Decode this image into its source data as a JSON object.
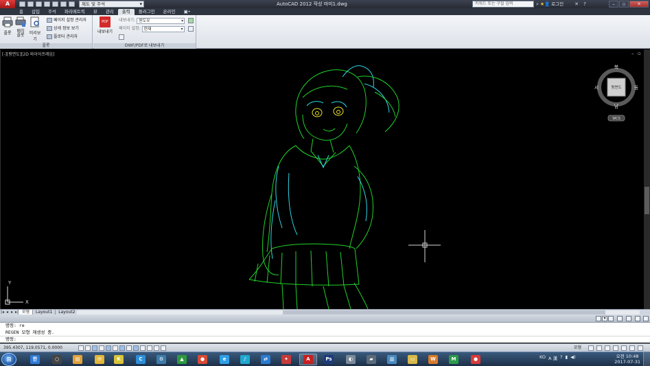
{
  "titlebar": {
    "app_logo": "A",
    "workspace": "제도 및 주석",
    "title": "AutoCAD 2012   작성 마미1.dwg",
    "search_placeholder": "키워드 또는 구절 입력",
    "login": "로그인",
    "icons": [
      "search-icon",
      "star-icon",
      "user-icon",
      "help-icon"
    ]
  },
  "tabs": [
    "홈",
    "삽입",
    "주석",
    "파라메트릭",
    "뷰",
    "관리",
    "출력",
    "플러그인",
    "온라인",
    "▣•"
  ],
  "ribbon": {
    "plot_panel": {
      "title": "플롯",
      "plot": "플롯",
      "batch_plot": "배치\n플롯",
      "preview": "미리보기",
      "page_setup": "페이지 설정 관리자",
      "details": "상세 정보 보기",
      "plotter_manager": "플로터 관리자"
    },
    "export_panel": {
      "title": "DWF/PDF로 내보내기",
      "export_button": "내보내기",
      "export_label": "내보내기:",
      "export_value": "윈도우",
      "page_setup_label": "페이지 설정:",
      "page_setup_value": "현재",
      "pdf_badge": "PDF"
    }
  },
  "viewport": {
    "label": "[-][평면도][2D 와이어프레임]",
    "viewcube": {
      "top_face": "평면도",
      "north": "북",
      "south": "남",
      "west": "서",
      "east": "동",
      "wcs": "WCS"
    },
    "ucs": {
      "x": "X",
      "y": "Y"
    },
    "drawing_colors": {
      "outline": "#22d32b",
      "detail": "#2fd7e6",
      "eyes": "#f2e82c"
    }
  },
  "layout_tabs": [
    "모형",
    "Layout1",
    "Layout2"
  ],
  "command": {
    "lines": [
      "명령: re",
      "REGEN 모형 재생성 중.",
      "",
      "명령:"
    ]
  },
  "status": {
    "coords": "395.4307, 119.0571, 0.0000",
    "model": "모형"
  },
  "taskbar": {
    "apps": [
      {
        "name": "hangul-icon",
        "label": "한",
        "color": "#2f7bd6"
      },
      {
        "name": "search-icon",
        "label": "○",
        "color": "#444"
      },
      {
        "name": "notes-icon",
        "label": "▤",
        "color": "#e0a23a"
      },
      {
        "name": "mail-icon",
        "label": "✉",
        "color": "#e2b63a"
      },
      {
        "name": "kakao-icon",
        "label": "K",
        "color": "#d7c43a"
      },
      {
        "name": "c-app-icon",
        "label": "C",
        "color": "#2d8fd8"
      },
      {
        "name": "settings-icon",
        "label": "⚙",
        "color": "#3d7ba8"
      },
      {
        "name": "vs-icon",
        "label": "▲",
        "color": "#2d9a3d"
      },
      {
        "name": "chrome-icon",
        "label": "●",
        "color": "#d94a35"
      },
      {
        "name": "ie-icon",
        "label": "e",
        "color": "#2f9ee6"
      },
      {
        "name": "music-icon",
        "label": "♪",
        "color": "#1fa7d0"
      },
      {
        "name": "teamviewer-icon",
        "label": "⇄",
        "color": "#2a7bd0"
      },
      {
        "name": "flashget-icon",
        "label": "✦",
        "color": "#c73a3a"
      },
      {
        "name": "autocad-icon",
        "label": "A",
        "color": "#c72020",
        "open": true
      },
      {
        "name": "photoshop-icon",
        "label": "Ps",
        "color": "#1d3b7a"
      },
      {
        "name": "media-icon",
        "label": "◐",
        "color": "#7a8a99"
      },
      {
        "name": "folder-icon",
        "label": "▰",
        "color": "#5a6a78"
      },
      {
        "name": "docs-icon",
        "label": "▥",
        "color": "#4a8ac0"
      },
      {
        "name": "explorer-icon",
        "label": "▭",
        "color": "#d9b94a"
      },
      {
        "name": "word-icon",
        "label": "W",
        "color": "#d97b2a"
      },
      {
        "name": "mq-icon",
        "label": "M",
        "color": "#2a9a4a"
      },
      {
        "name": "record-icon",
        "label": "●",
        "color": "#d93a3a"
      }
    ],
    "tray": [
      "KO",
      "A 漢",
      "?"
    ],
    "time": "오전 10:48",
    "date": "2017-07-31"
  }
}
